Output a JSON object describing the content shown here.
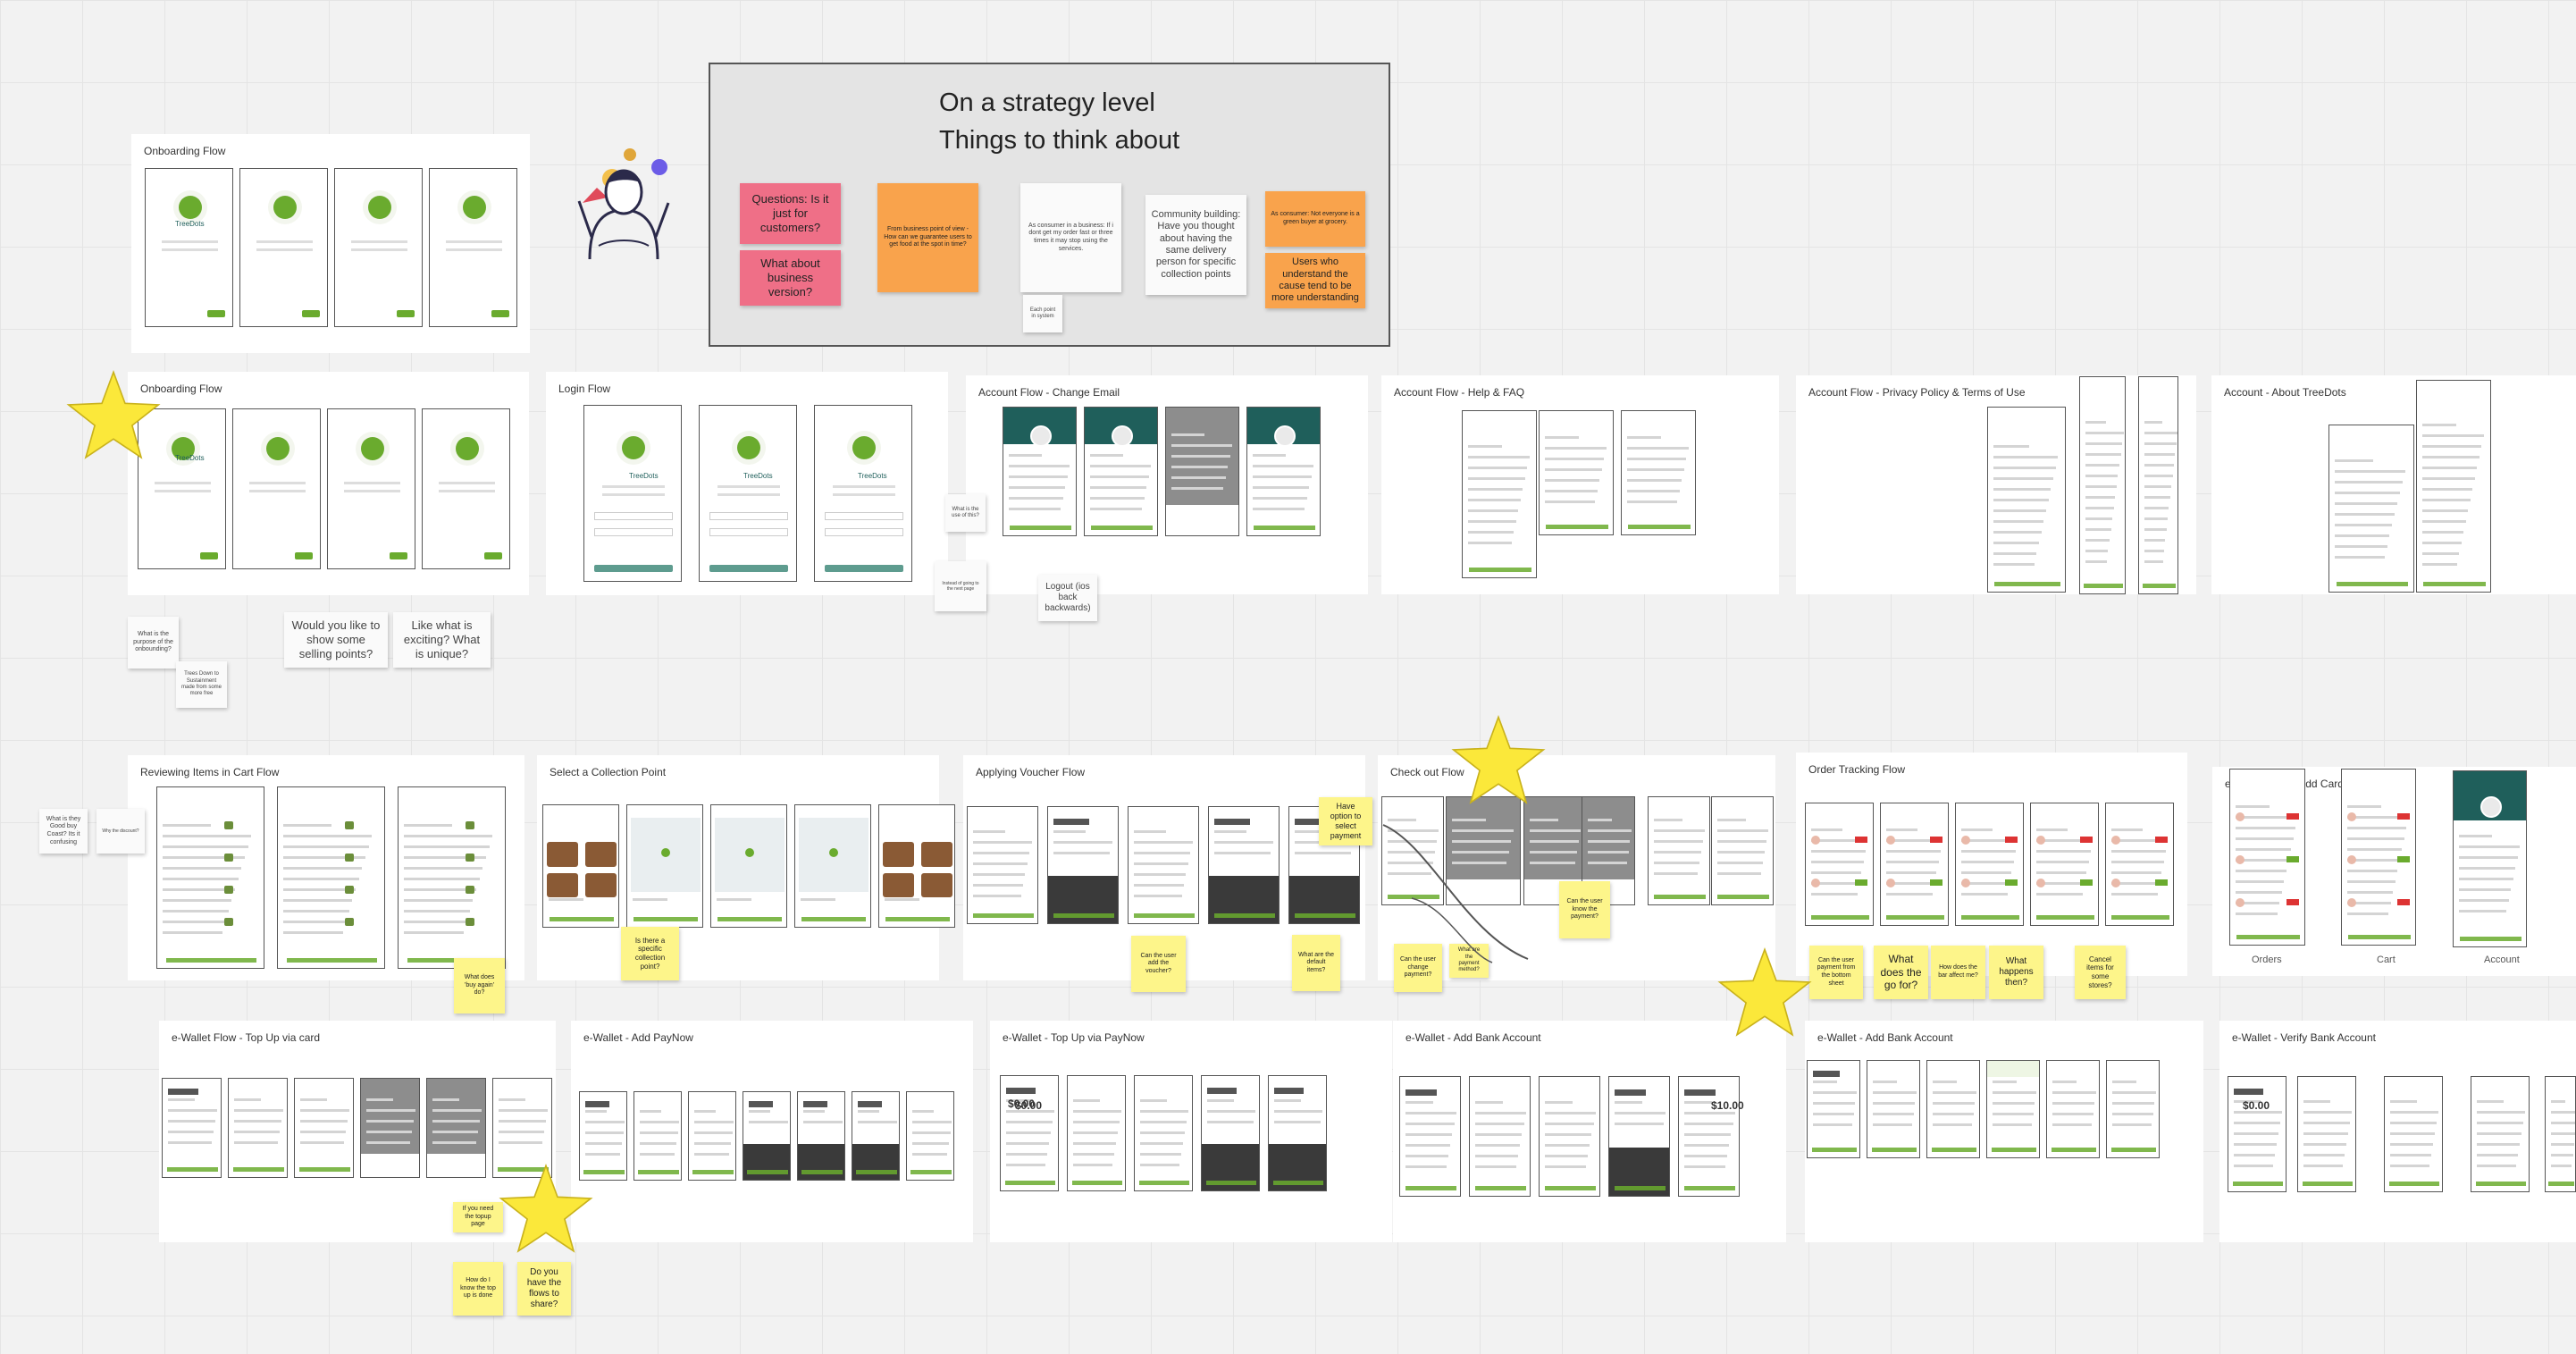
{
  "board": {
    "strategy": {
      "title_line1": "On a strategy level",
      "title_line2": "Things to think about",
      "notes": [
        "Questions: Is it just for customers?",
        "What about business version?",
        "From business point of view - How can we guarantee users to get food at the spot in time?",
        "As consumer in a business: If i dont get my order fast or three times it may stop using the services.",
        "Community building: Have you thought about having the same delivery person for specific collection points",
        "As consumer: Not everyone is a green buyer at grocery.",
        "Users who understand the cause tend to be more understanding",
        "Each point in system"
      ]
    },
    "frames": [
      {
        "title": "Onboarding Flow"
      },
      {
        "title": "Onboarding Flow"
      },
      {
        "title": "Login Flow"
      },
      {
        "title": "Account Flow - Change Email"
      },
      {
        "title": "Account Flow - Help & FAQ"
      },
      {
        "title": "Account Flow - Privacy Policy & Terms of Use"
      },
      {
        "title": "Account - About TreeDots"
      },
      {
        "title": "Reviewing Items in Cart Flow"
      },
      {
        "title": "Select a Collection Point"
      },
      {
        "title": "Applying Voucher Flow"
      },
      {
        "title": "Check out Flow"
      },
      {
        "title": "Order Tracking Flow"
      },
      {
        "title": "e-Wallet Flow - Add Card for Top Up"
      },
      {
        "title": "e-Wallet Flow - Top Up via card"
      },
      {
        "title": "e-Wallet - Add PayNow"
      },
      {
        "title": "e-Wallet - Top Up via PayNow"
      },
      {
        "title": "e-Wallet - Add Bank Account"
      },
      {
        "title": "e-Wallet - Verify Bank Account"
      }
    ],
    "notes": [
      "What is the purpose of the onbounding?",
      "Would you like to show some selling points?",
      "Like what is exciting? What is unique?",
      "Trees Down to Sustainment made from some more free",
      "What is the use of this?",
      "Instead of going to the next page",
      "Logout (ios back backwards)",
      "What is they Good buy Coast? Its it confusing",
      "Why the discount?",
      "Is there a specific collection point?",
      "Have option to select payment",
      "Can the user add the voucher?",
      "What are the default items?",
      "Can the user know the payment?",
      "Can the user change payment?",
      "What are the payment method?",
      "Can the user payment from the bottom sheet",
      "What does the go for?",
      "How does the bar affect me?",
      "What happens then?",
      "Cancel items for some stores?",
      "What does 'buy again' do?",
      "If you need the topup page",
      "How do I know the top up is done",
      "Do you have the flows to share?"
    ],
    "tabs": [
      "Orders",
      "Cart",
      "Account"
    ],
    "amounts": [
      "$0.00",
      "$10.00"
    ],
    "brand": "TreeDots",
    "colors": {
      "green": "#6aab2e",
      "teal": "#1f5f5b",
      "yellow": "#fdf58a",
      "pink": "#ef6f87",
      "orange": "#f9a34c",
      "star": "#fbe83a"
    }
  }
}
